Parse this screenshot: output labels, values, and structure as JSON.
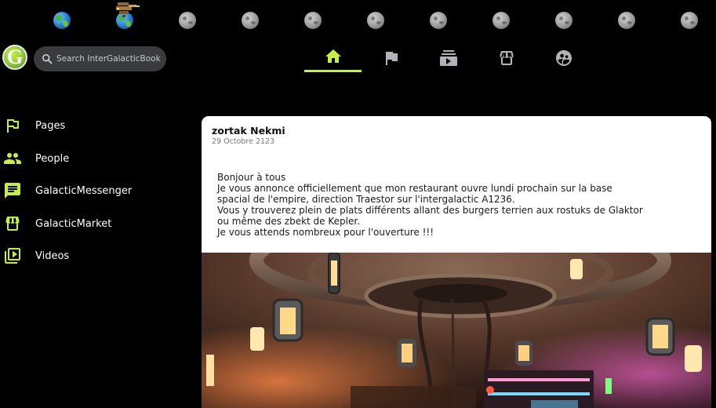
{
  "header": {
    "logo_letter": "G",
    "search": {
      "placeholder": "Search InterGalacticBook"
    },
    "planets": [
      "earth",
      "earth",
      "moon",
      "moon",
      "moon",
      "moon",
      "moon",
      "moon",
      "moon",
      "moon",
      "moon"
    ],
    "nav_tabs": [
      {
        "icon": "home-icon",
        "active": true
      },
      {
        "icon": "flag-icon",
        "active": false
      },
      {
        "icon": "video-library-icon",
        "active": false
      },
      {
        "icon": "storefront-icon",
        "active": false
      },
      {
        "icon": "groups-icon",
        "active": false
      }
    ],
    "accent_color": "#c6ee45"
  },
  "sidebar": {
    "items": [
      {
        "label": "Pages",
        "icon": "flag-icon"
      },
      {
        "label": "People",
        "icon": "people-icon"
      },
      {
        "label": "GalacticMessenger",
        "icon": "chat-icon"
      },
      {
        "label": "GalacticMarket",
        "icon": "storefront-icon"
      },
      {
        "label": "Videos",
        "icon": "video-library-icon"
      }
    ]
  },
  "post": {
    "author": "zortak Nekmi",
    "date": "29 Octobre 2123",
    "lines": [
      "Bonjour à tous",
      "Je vous annonce officiellement que mon restaurant ouvre lundi prochain sur la base",
      "spacial de l'empire, direction Traestor sur l'intergalactic A1236.",
      "Vous y trouverez plein de plats différents allant des burgers terrien aux rostuks de Glaktor",
      "ou même des zbekt de Kepler.",
      "Je vous attends nombreux pour l'ouverture !!!"
    ]
  }
}
